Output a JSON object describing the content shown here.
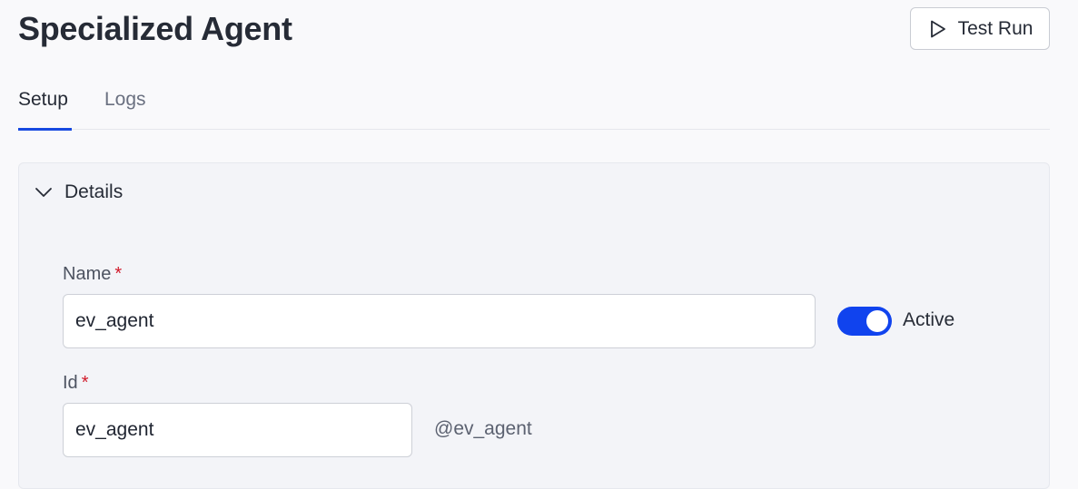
{
  "header": {
    "title": "Specialized Agent",
    "test_run_label": "Test Run",
    "test_run_icon": "play-icon"
  },
  "tabs": [
    {
      "label": "Setup",
      "active": true
    },
    {
      "label": "Logs",
      "active": false
    }
  ],
  "details": {
    "section_title": "Details",
    "expanded": true,
    "name": {
      "label": "Name",
      "required_mark": "*",
      "value": "ev_agent"
    },
    "active_toggle": {
      "label": "Active",
      "on": true
    },
    "id": {
      "label": "Id",
      "required_mark": "*",
      "value": "ev_agent",
      "handle": "@ev_agent"
    }
  },
  "colors": {
    "accent": "#1043ee",
    "required": "#d11a2a",
    "background": "#f9f9fb",
    "card": "#f3f4f8"
  }
}
